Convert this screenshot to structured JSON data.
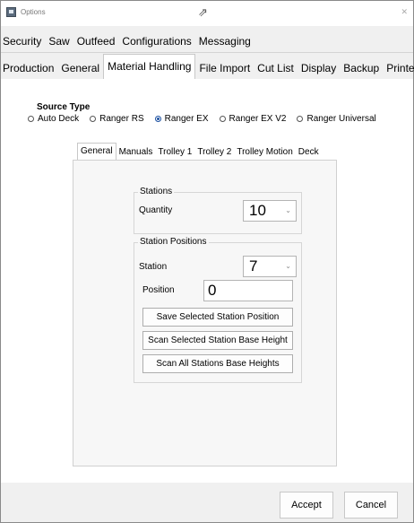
{
  "window": {
    "title": "Options"
  },
  "tabs_row1": [
    "Security",
    "Saw",
    "Outfeed",
    "Configurations",
    "Messaging"
  ],
  "tabs_row2": [
    "Production",
    "General",
    "Material Handling",
    "File Import",
    "Cut List",
    "Display",
    "Backup",
    "Printers"
  ],
  "active_tab": "Material Handling",
  "source_type": {
    "label": "Source Type",
    "options": [
      "Auto Deck",
      "Ranger RS",
      "Ranger EX",
      "Ranger EX V2",
      "Ranger Universal"
    ],
    "selected": "Ranger EX"
  },
  "inner_tabs": [
    "General",
    "Manuals",
    "Trolley 1",
    "Trolley 2",
    "Trolley Motion",
    "Deck"
  ],
  "inner_active_tab": "General",
  "stations": {
    "group_title": "Stations",
    "quantity_label": "Quantity",
    "quantity_value": "10"
  },
  "station_positions": {
    "group_title": "Station Positions",
    "station_label": "Station",
    "station_value": "7",
    "position_label": "Position",
    "position_value": "0",
    "save_button": "Save Selected Station Position",
    "scan_selected_button": "Scan Selected Station Base Height",
    "scan_all_button": "Scan All Stations Base Heights"
  },
  "footer": {
    "accept": "Accept",
    "cancel": "Cancel"
  }
}
